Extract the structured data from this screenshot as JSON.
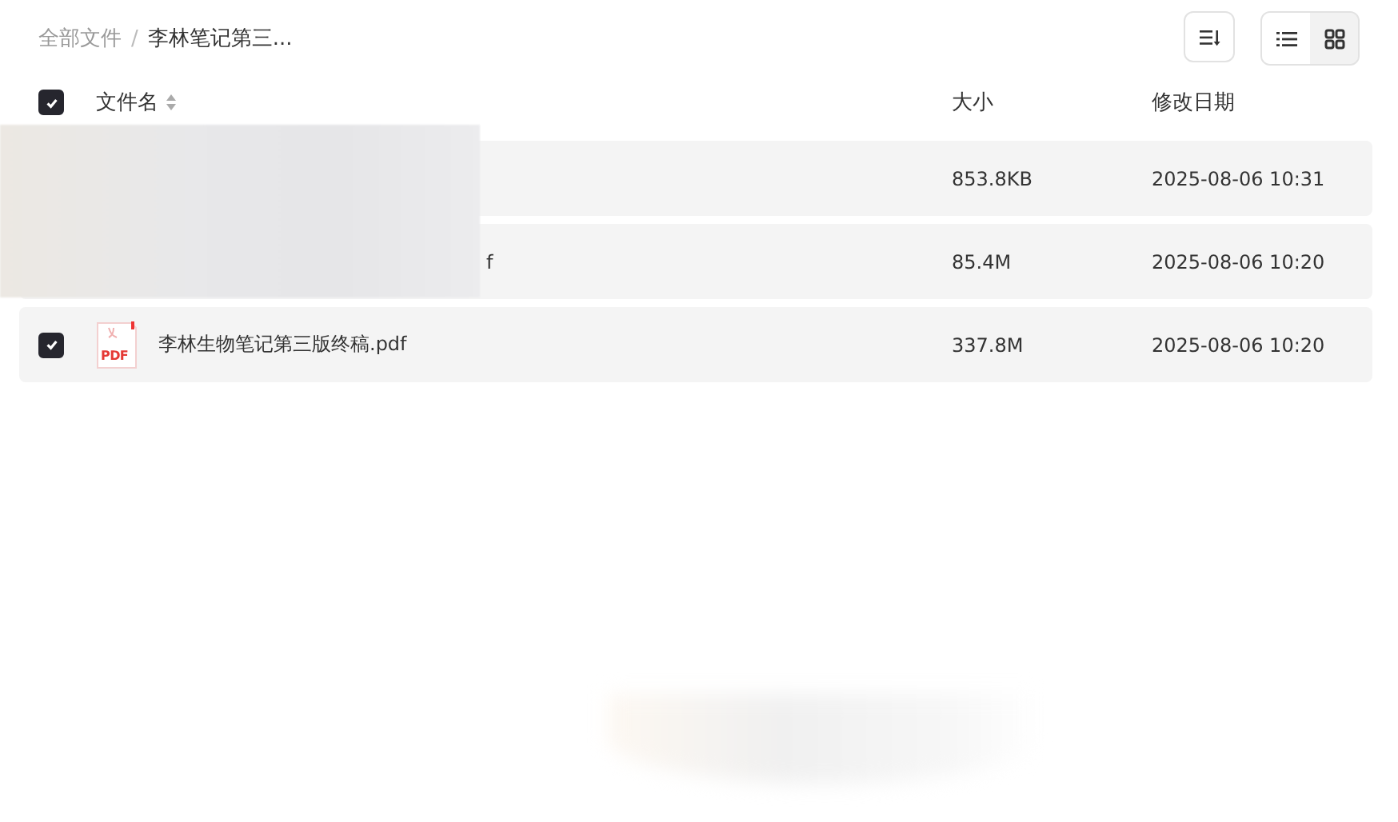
{
  "breadcrumb_separator": "/",
  "breadcrumb": [
    {
      "label": "全部文件",
      "current": false
    },
    {
      "label": "李林笔记第三...",
      "current": true
    }
  ],
  "view_modes": [
    {
      "kind": "list",
      "selected": true
    },
    {
      "kind": "grid",
      "selected": false
    }
  ],
  "table": {
    "columns": [
      "文件名",
      "大小",
      "修改日期"
    ],
    "header_checked": true,
    "rows": [
      {
        "size": "853.8KB",
        "modified": "2025-08-06 10:31"
      },
      {
        "name": "f",
        "size": "85.4M",
        "modified": "2025-08-06 10:20"
      },
      {
        "kind": "pdf",
        "icon_label": "PDF",
        "checked": true,
        "name": "李林生物笔记第三版终稿.pdf",
        "size": "337.8M",
        "modified": "2025-08-06 10:20"
      }
    ]
  }
}
